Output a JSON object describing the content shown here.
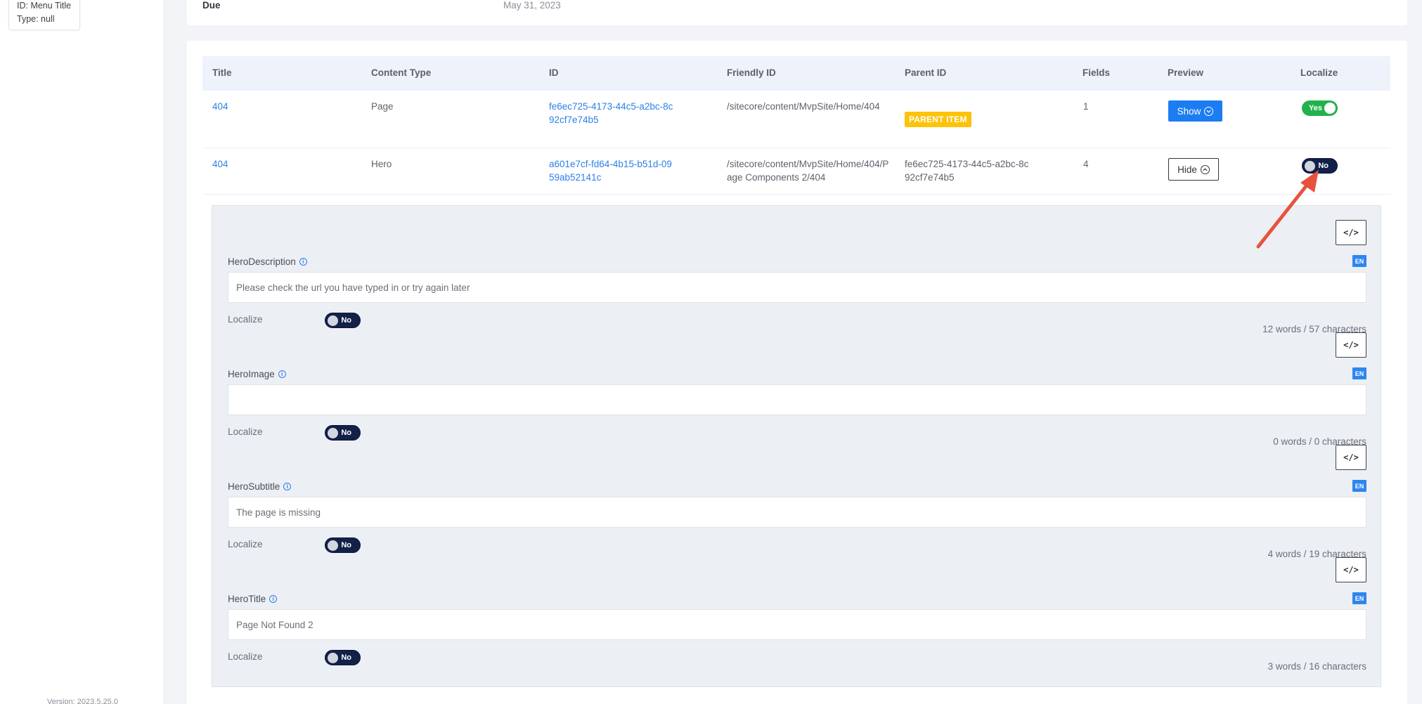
{
  "sidebar": {
    "tooltip": {
      "line1": "ID: Menu Title",
      "line2": "Type: null"
    },
    "version": "Version: 2023.5.25.0"
  },
  "header_card": {
    "due_label": "Due",
    "due_value": "May 31, 2023"
  },
  "table": {
    "columns": [
      "Title",
      "Content Type",
      "ID",
      "Friendly ID",
      "Parent ID",
      "Fields",
      "Preview",
      "Localize"
    ],
    "rows": [
      {
        "title": "404",
        "content_type": "Page",
        "id": "fe6ec725-4173-44c5-a2bc-8c92cf7e74b5",
        "friendly_id": "/sitecore/content/MvpSite/Home/404",
        "parent_badge": "PARENT ITEM",
        "fields": "1",
        "preview_label": "Show",
        "localize": "Yes"
      },
      {
        "title": "404",
        "content_type": "Hero",
        "id": "a601e7cf-fd64-4b15-b51d-0959ab52141c",
        "friendly_id": "/sitecore/content/MvpSite/Home/404/Page Components 2/404",
        "parent_id": "fe6ec725-4173-44c5-a2bc-8c92cf7e74b5",
        "fields": "4",
        "preview_label": "Hide",
        "localize": "No"
      }
    ]
  },
  "fields": [
    {
      "name": "HeroDescription",
      "lang": "EN",
      "value": "Please check the url you have typed in or try again later",
      "localize_label": "Localize",
      "localize": "No",
      "counter": "12 words / 57 characters",
      "code_label": "</>"
    },
    {
      "name": "HeroImage",
      "lang": "EN",
      "value": "",
      "localize_label": "Localize",
      "localize": "No",
      "counter": "0 words / 0 characters",
      "code_label": "</>"
    },
    {
      "name": "HeroSubtitle",
      "lang": "EN",
      "value": "The page is missing",
      "localize_label": "Localize",
      "localize": "No",
      "counter": "4 words / 19 characters",
      "code_label": "</>"
    },
    {
      "name": "HeroTitle",
      "lang": "EN",
      "value": "Page Not Found 2",
      "localize_label": "Localize",
      "localize": "No",
      "counter": "3 words / 16 characters",
      "code_label": "</>"
    }
  ],
  "colors": {
    "accent": "#1c7df3",
    "toggle_yes": "#22b24c",
    "toggle_no": "#12214a",
    "parent_badge": "#fdc30a",
    "annotation_arrow": "#e8523d"
  },
  "icons": {
    "show": "chevron-down-circle-icon",
    "hide": "chevron-up-circle-icon",
    "info": "info-icon",
    "code": "code-icon"
  }
}
